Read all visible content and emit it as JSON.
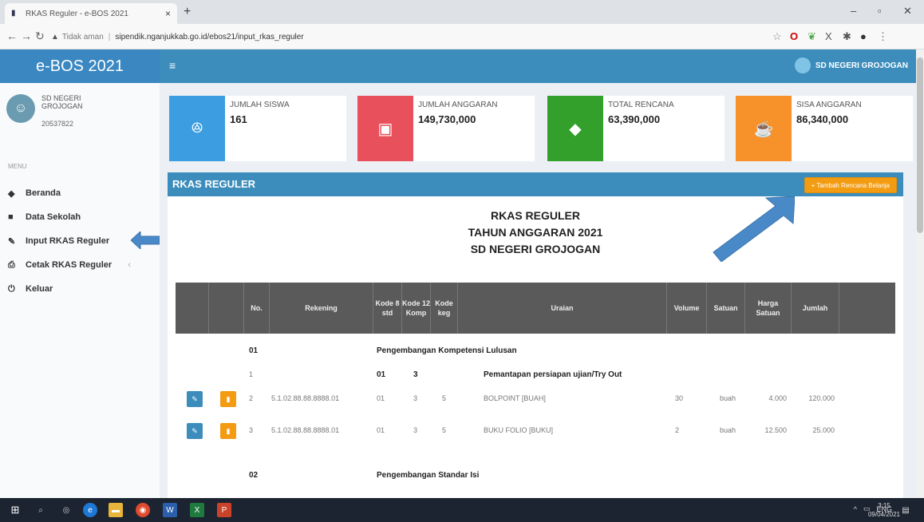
{
  "browser": {
    "tab_title": "RKAS Reguler - e-BOS 2021",
    "tab_close": "×",
    "new_tab": "+",
    "security": "Tidak aman",
    "url": "sipendik.nganjukkab.go.id/ebos21/input_rkas_reguler"
  },
  "app": {
    "brand": "e-BOS 2021",
    "user_name": "SD NEGERI GROJOGAN"
  },
  "profile": {
    "name": "SD NEGERI GROJOGAN",
    "id": "20537822"
  },
  "menu": {
    "heading": "MENU",
    "items": [
      {
        "label": "Beranda",
        "icon": "dashboard-icon"
      },
      {
        "label": "Data Sekolah",
        "icon": "book-icon"
      },
      {
        "label": "Input RKAS Reguler",
        "icon": "edit-icon"
      },
      {
        "label": "Cetak RKAS Reguler",
        "icon": "print-icon"
      },
      {
        "label": "Keluar",
        "icon": "power-icon"
      }
    ]
  },
  "stats": [
    {
      "label": "JUMLAH SISWA",
      "value": "161",
      "color": "#3c9de0",
      "icon": "students-icon"
    },
    {
      "label": "JUMLAH ANGGARAN",
      "value": "149,730,000",
      "color": "#e8505b",
      "icon": "money-icon"
    },
    {
      "label": "TOTAL RENCANA",
      "value": "63,390,000",
      "color": "#33a02c",
      "icon": "tag-icon"
    },
    {
      "label": "SISA ANGGARAN",
      "value": "86,340,000",
      "color": "#f7912a",
      "icon": "coffee-icon"
    }
  ],
  "panel": {
    "title": "RKAS REGULER",
    "add_button": "+ Tambah Rencana Belanja",
    "heading_lines": [
      "RKAS REGULER",
      "TAHUN ANGGARAN 2021",
      "SD NEGERI GROJOGAN"
    ]
  },
  "table": {
    "headers": {
      "no": "No.",
      "rekening": "Rekening",
      "kode8": "Kode 8 std",
      "kode12": "Kode 12 Komp",
      "kodekeg": "Kode keg",
      "uraian": "Uraian",
      "volume": "Volume",
      "satuan": "Satuan",
      "harga": "Harga Satuan",
      "jumlah": "Jumlah"
    },
    "rows": [
      {
        "no": "01",
        "rekening": "",
        "kode8": "",
        "kode12": "",
        "kodekeg": "",
        "uraian": "Pengembangan Kompetensi Lulusan",
        "volume": "",
        "satuan": "",
        "harga": "",
        "jumlah": ""
      },
      {
        "no": "1",
        "rekening": "",
        "kode8": "01",
        "kode12": "3",
        "kodekeg": "",
        "uraian": "Pemantapan persiapan ujian/Try Out",
        "volume": "",
        "satuan": "",
        "harga": "",
        "jumlah": ""
      },
      {
        "no": "2",
        "rekening": "5.1.02.88.88.8888.01",
        "kode8": "01",
        "kode12": "3",
        "kodekeg": "5",
        "uraian": "BOLPOINT [BUAH]",
        "volume": "30",
        "satuan": "buah",
        "harga": "4.000",
        "jumlah": "120.000"
      },
      {
        "no": "3",
        "rekening": "5.1.02.88.88.8888.01",
        "kode8": "01",
        "kode12": "3",
        "kodekeg": "5",
        "uraian": "BUKU FOLIO [BUKU]",
        "volume": "2",
        "satuan": "buah",
        "harga": "12.500",
        "jumlah": "25.000"
      },
      {
        "no": "02",
        "rekening": "",
        "kode8": "",
        "kode12": "",
        "kodekeg": "",
        "uraian": "Pengembangan Standar Isi",
        "volume": "",
        "satuan": "",
        "harga": "",
        "jumlah": ""
      }
    ]
  },
  "taskbar": {
    "lang": "ENG",
    "time": "3:15",
    "date": "09/04/2021"
  }
}
